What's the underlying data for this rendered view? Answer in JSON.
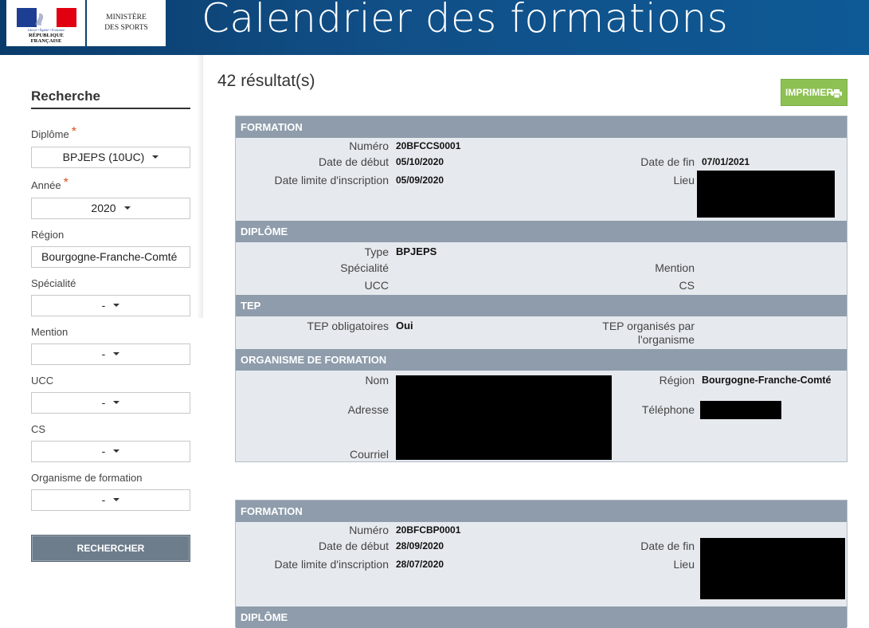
{
  "header": {
    "devise": "Liberté • Égalité • Fraternité",
    "republique": "RÉPUBLIQUE FRANÇAISE",
    "ministry_line1": "MINISTÈRE",
    "ministry_line2": "DES SPORTS",
    "site_title": "Calendrier des formations"
  },
  "sidebar": {
    "title": "Recherche",
    "diplome_label": "Diplôme",
    "diplome_value": "BPJEPS (10UC)",
    "annee_label": "Année",
    "annee_value": "2020",
    "region_label": "Région",
    "region_value": "Bourgogne-Franche-Comté",
    "specialite_label": "Spécialité",
    "specialite_value": "-",
    "mention_label": "Mention",
    "mention_value": "-",
    "ucc_label": "UCC",
    "ucc_value": "-",
    "cs_label": "CS",
    "cs_value": "-",
    "organisme_label": "Organisme de formation",
    "organisme_value": "-",
    "required_mark": "*",
    "search_button": "RECHERCHER"
  },
  "main": {
    "results_count": "42 résultat(s)",
    "print_button": "IMPRIMER"
  },
  "card1": {
    "formation_header": "FORMATION",
    "numero_label": "Numéro",
    "numero_value": "20BFCCS0001",
    "debut_label": "Date de début",
    "debut_value": "05/10/2020",
    "fin_label": "Date de fin",
    "fin_value": "07/01/2021",
    "limite_label": "Date limite d'inscription",
    "limite_value": "05/09/2020",
    "lieu_label": "Lieu",
    "diplome_header": "DIPLÔME",
    "type_label": "Type",
    "type_value": "BPJEPS",
    "specialite_label": "Spécialité",
    "mention_label": "Mention",
    "ucc_label": "UCC",
    "cs_label": "CS",
    "tep_header": "TEP",
    "tep_oblig_label": "TEP obligatoires",
    "tep_oblig_value": "Oui",
    "tep_org_label_1": "TEP organisés par",
    "tep_org_label_2": "l'organisme",
    "organisme_header": "ORGANISME DE FORMATION",
    "nom_label": "Nom",
    "region_label": "Région",
    "region_value": "Bourgogne-Franche-Comté",
    "adresse_label": "Adresse",
    "telephone_label": "Téléphone",
    "courriel_label": "Courriel"
  },
  "card2": {
    "formation_header": "FORMATION",
    "numero_label": "Numéro",
    "numero_value": "20BFCBP0001",
    "debut_label": "Date de début",
    "debut_value": "28/09/2020",
    "fin_label": "Date de fin",
    "limite_label": "Date limite d'inscription",
    "limite_value": "28/07/2020",
    "lieu_label": "Lieu",
    "diplome_header": "DIPLÔME"
  }
}
